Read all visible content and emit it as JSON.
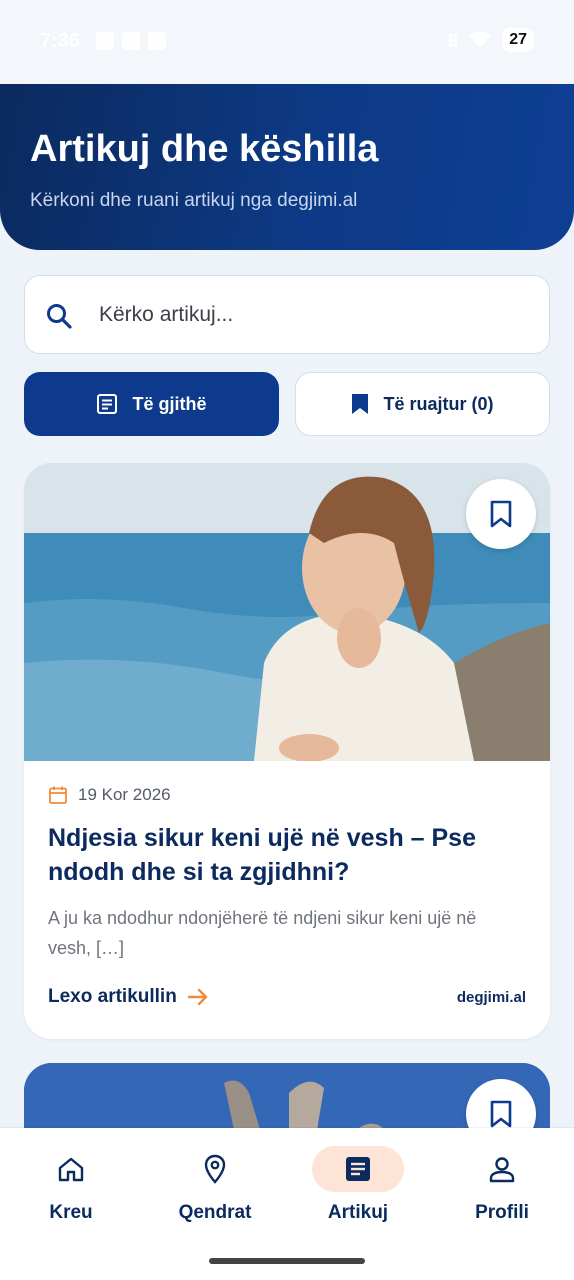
{
  "status_bar": {
    "time": "7:36",
    "battery": "27"
  },
  "header": {
    "title": "Artikuj dhe këshilla",
    "subtitle": "Kërkoni dhe ruani artikuj nga degjimi.al"
  },
  "search": {
    "placeholder": "Kërko artikuj..."
  },
  "tabs": [
    {
      "label": "Të gjithë",
      "icon": "article-icon",
      "active": true
    },
    {
      "label": "Të ruajtur (0)",
      "icon": "bookmark-icon",
      "active": false
    }
  ],
  "articles": [
    {
      "date": "19 Kor 2026",
      "title": "Ndjesia sikur keni ujë në vesh – Pse ndodh dhe si ta zgjidhni?",
      "excerpt": "A ju ka ndodhur ndonjëherë të ndjeni sikur keni ujë në vesh, […]",
      "read_more": "Lexo artikullin",
      "source": "degjimi.al"
    }
  ],
  "bottom_nav": [
    {
      "label": "Kreu",
      "icon": "home-icon",
      "active": false
    },
    {
      "label": "Qendrat",
      "icon": "location-pin-icon",
      "active": false
    },
    {
      "label": "Artikuj",
      "icon": "article-icon",
      "active": true
    },
    {
      "label": "Profili",
      "icon": "person-icon",
      "active": false
    }
  ],
  "colors": {
    "primary": "#0d3a8c",
    "text_dark": "#0b2a5e",
    "accent": "#f08a3c",
    "active_pill": "#fde4d6",
    "background": "#eef3f9"
  }
}
